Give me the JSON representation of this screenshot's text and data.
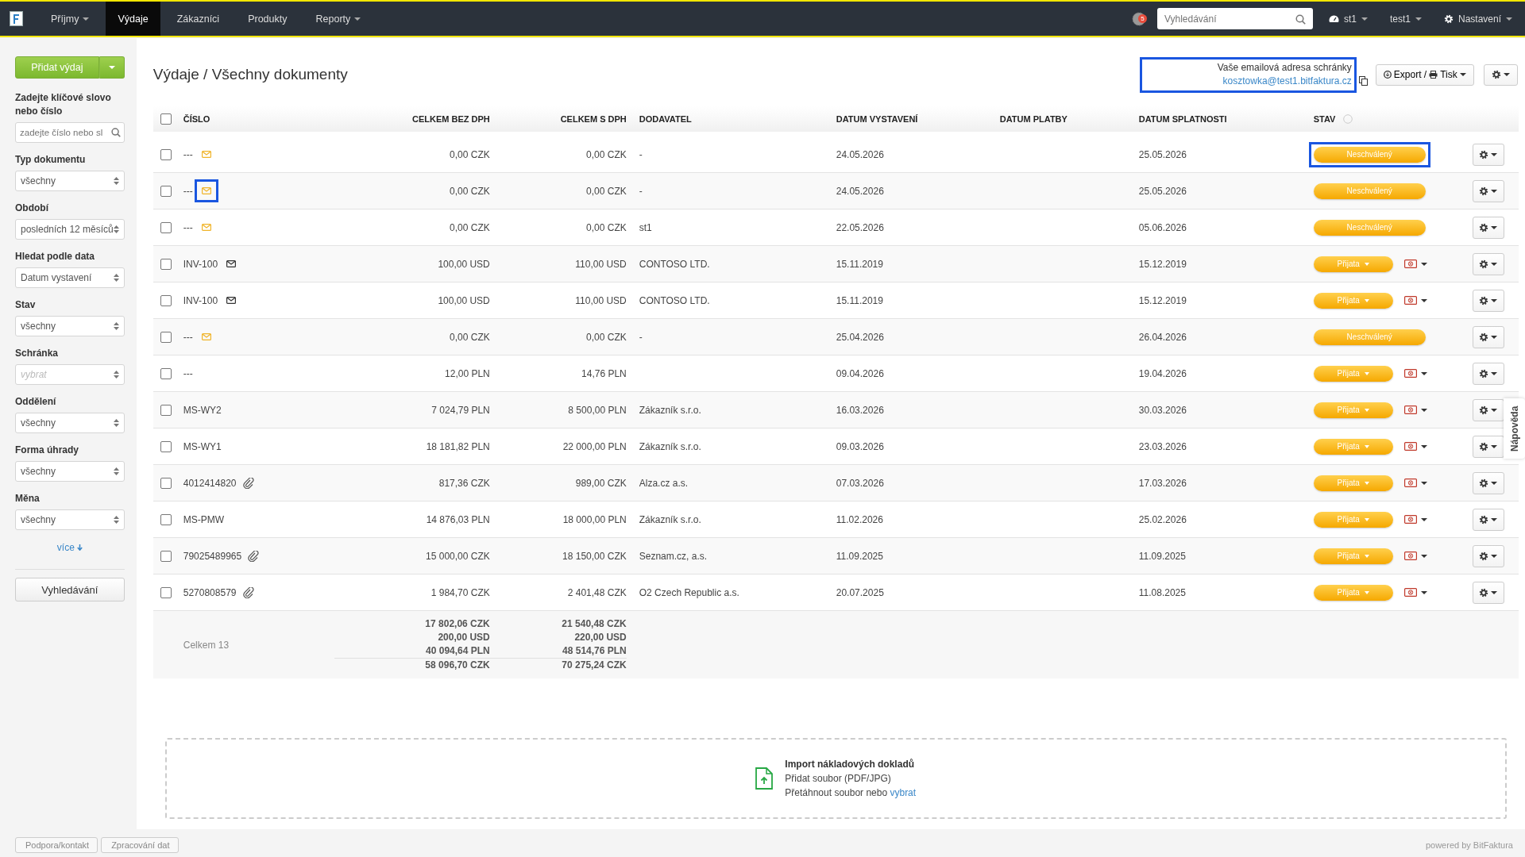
{
  "nav": {
    "items": [
      {
        "label": "Příjmy",
        "dropdown": true,
        "selected": false
      },
      {
        "label": "Výdaje",
        "dropdown": false,
        "selected": true
      },
      {
        "label": "Zákazníci",
        "dropdown": false,
        "selected": false
      },
      {
        "label": "Produkty",
        "dropdown": false,
        "selected": false
      },
      {
        "label": "Reporty",
        "dropdown": true,
        "selected": false
      }
    ],
    "badge": "5",
    "search_placeholder": "Vyhledávání",
    "user_menus": [
      {
        "kind": "dashboard",
        "label": "st1"
      },
      {
        "kind": "plain",
        "label": "test1"
      },
      {
        "kind": "settings",
        "label": "Nastavení"
      }
    ]
  },
  "sidebar": {
    "add_button": "Přidat výdaj",
    "keyword_label": "Zadejte klíčové slovo nebo číslo",
    "keyword_placeholder": "zadejte číslo nebo sl",
    "filters": [
      {
        "label": "Typ dokumentu",
        "value": "všechny"
      },
      {
        "label": "Období",
        "value": "posledních 12 měsíců"
      },
      {
        "label": "Hledat podle data",
        "value": "Datum vystavení"
      },
      {
        "label": "Stav",
        "value": "všechny"
      },
      {
        "label": "Schránka",
        "placeholder": "vybrat"
      },
      {
        "label": "Oddělení",
        "value": "všechny"
      },
      {
        "label": "Forma úhrady",
        "value": "všechny"
      },
      {
        "label": "Měna",
        "value": "všechny"
      }
    ],
    "more_link": "více",
    "search_button": "Vyhledávání"
  },
  "title": "Výdaje / Všechny dokumenty",
  "mailbox": {
    "label": "Vaše emailová adresa schránky",
    "email": "kosztowka@test1.bitfaktura.cz",
    "highlighted": true
  },
  "export_button": "Export / ",
  "print_label": "Tisk",
  "table": {
    "columns": [
      "ČÍSLO",
      "CELKEM BEZ DPH",
      "CELKEM S DPH",
      "DODAVATEL",
      "DATUM VYSTAVENÍ",
      "DATUM PLATBY",
      "DATUM SPLATNOSTI",
      "STAV"
    ],
    "all_checked": false,
    "rows": [
      {
        "checked": false,
        "number": "---",
        "via_email": true,
        "email_new": true,
        "has_attachment": false,
        "net": "0,00 CZK",
        "gross": "0,00 CZK",
        "supplier": "-",
        "issued": "24.05.2026",
        "due": "25.05.2026",
        "status": {
          "kind": "pending",
          "label": "Neschválený"
        },
        "icon_highlighted": false,
        "status_highlighted": true
      },
      {
        "checked": false,
        "number": "---",
        "via_email": true,
        "email_new": true,
        "has_attachment": false,
        "net": "0,00 CZK",
        "gross": "0,00 CZK",
        "supplier": "-",
        "issued": "24.05.2026",
        "due": "25.05.2026",
        "status": {
          "kind": "pending",
          "label": "Neschválený"
        },
        "icon_highlighted": true,
        "status_highlighted": false
      },
      {
        "checked": false,
        "number": "---",
        "via_email": true,
        "email_new": true,
        "has_attachment": false,
        "net": "0,00 CZK",
        "gross": "0,00 CZK",
        "supplier": "st1",
        "issued": "22.05.2026",
        "due": "05.06.2026",
        "status": {
          "kind": "pending",
          "label": "Neschválený"
        },
        "icon_highlighted": false,
        "status_highlighted": false
      },
      {
        "checked": false,
        "number": "INV-100",
        "via_email": true,
        "email_new": false,
        "has_attachment": false,
        "net": "100,00 USD",
        "gross": "110,00 USD",
        "supplier": "CONTOSO LTD.",
        "issued": "15.11.2019",
        "due": "15.12.2019",
        "status": {
          "kind": "accepted",
          "label": "Přijata"
        },
        "icon_highlighted": false,
        "status_highlighted": false
      },
      {
        "checked": false,
        "number": "INV-100",
        "via_email": true,
        "email_new": false,
        "has_attachment": false,
        "net": "100,00 USD",
        "gross": "110,00 USD",
        "supplier": "CONTOSO LTD.",
        "issued": "15.11.2019",
        "due": "15.12.2019",
        "status": {
          "kind": "accepted",
          "label": "Přijata"
        },
        "icon_highlighted": false,
        "status_highlighted": false
      },
      {
        "checked": false,
        "number": "---",
        "via_email": true,
        "email_new": true,
        "has_attachment": false,
        "net": "0,00 CZK",
        "gross": "0,00 CZK",
        "supplier": "-",
        "issued": "25.04.2026",
        "due": "26.04.2026",
        "status": {
          "kind": "pending",
          "label": "Neschválený"
        },
        "icon_highlighted": false,
        "status_highlighted": false
      },
      {
        "checked": false,
        "number": "---",
        "via_email": false,
        "email_new": false,
        "has_attachment": false,
        "net": "12,00 PLN",
        "gross": "14,76 PLN",
        "issued": "09.04.2026",
        "due": "19.04.2026",
        "status": {
          "kind": "accepted",
          "label": "Přijata"
        },
        "icon_highlighted": false,
        "status_highlighted": false
      },
      {
        "checked": false,
        "number": "MS-WY2",
        "via_email": false,
        "email_new": false,
        "has_attachment": false,
        "net": "7 024,79 PLN",
        "gross": "8 500,00 PLN",
        "supplier": "Zákazník s.r.o.",
        "issued": "16.03.2026",
        "due": "30.03.2026",
        "status": {
          "kind": "accepted",
          "label": "Přijata"
        },
        "icon_highlighted": false,
        "status_highlighted": false
      },
      {
        "checked": false,
        "number": "MS-WY1",
        "via_email": false,
        "email_new": false,
        "has_attachment": false,
        "net": "18 181,82 PLN",
        "gross": "22 000,00 PLN",
        "supplier": "Zákazník s.r.o.",
        "issued": "09.03.2026",
        "due": "23.03.2026",
        "status": {
          "kind": "accepted",
          "label": "Přijata"
        },
        "icon_highlighted": false,
        "status_highlighted": false
      },
      {
        "checked": false,
        "number": "4012414820",
        "via_email": false,
        "email_new": false,
        "has_attachment": true,
        "net": "817,36 CZK",
        "gross": "989,00 CZK",
        "supplier": "Alza.cz a.s.",
        "issued": "07.03.2026",
        "due": "17.03.2026",
        "status": {
          "kind": "accepted",
          "label": "Přijata"
        },
        "icon_highlighted": false,
        "status_highlighted": false
      },
      {
        "checked": false,
        "number": "MS-PMW",
        "via_email": false,
        "email_new": false,
        "has_attachment": false,
        "net": "14 876,03 PLN",
        "gross": "18 000,00 PLN",
        "supplier": "Zákazník s.r.o.",
        "issued": "11.02.2026",
        "due": "25.02.2026",
        "status": {
          "kind": "accepted",
          "label": "Přijata"
        },
        "icon_highlighted": false,
        "status_highlighted": false
      },
      {
        "checked": false,
        "number": "79025489965",
        "via_email": false,
        "email_new": false,
        "has_attachment": true,
        "net": "15 000,00 CZK",
        "gross": "18 150,00 CZK",
        "supplier": "Seznam.cz, a.s.",
        "issued": "11.09.2025",
        "due": "11.09.2025",
        "status": {
          "kind": "accepted",
          "label": "Přijata"
        },
        "icon_highlighted": false,
        "status_highlighted": false
      },
      {
        "checked": false,
        "number": "5270808579",
        "via_email": false,
        "email_new": false,
        "has_attachment": true,
        "net": "1 984,70 CZK",
        "gross": "2 401,48 CZK",
        "supplier": "O2 Czech Republic a.s.",
        "issued": "20.07.2025",
        "due": "11.08.2025",
        "status": {
          "kind": "accepted",
          "label": "Přijata"
        },
        "icon_highlighted": false,
        "status_highlighted": false
      }
    ],
    "totals": {
      "label": "Celkem 13",
      "net": [
        "17 802,06 CZK",
        "200,00 USD",
        "40 094,64 PLN"
      ],
      "net_sum": "58 096,70 CZK",
      "gross": [
        "21 540,48 CZK",
        "220,00 USD",
        "48 514,76 PLN"
      ],
      "gross_sum": "70 275,24 CZK"
    }
  },
  "import": {
    "title": "Import nákladových dokladů",
    "line1": "Přidat soubor (PDF/JPG)",
    "line2": "Přetáhnout soubor nebo ",
    "link": "vybrat"
  },
  "help_tab": "Nápověda",
  "footer": {
    "buttons": [
      "Podpora/kontakt",
      "Zpracování dat"
    ],
    "powered": "powered by BitFaktura"
  }
}
